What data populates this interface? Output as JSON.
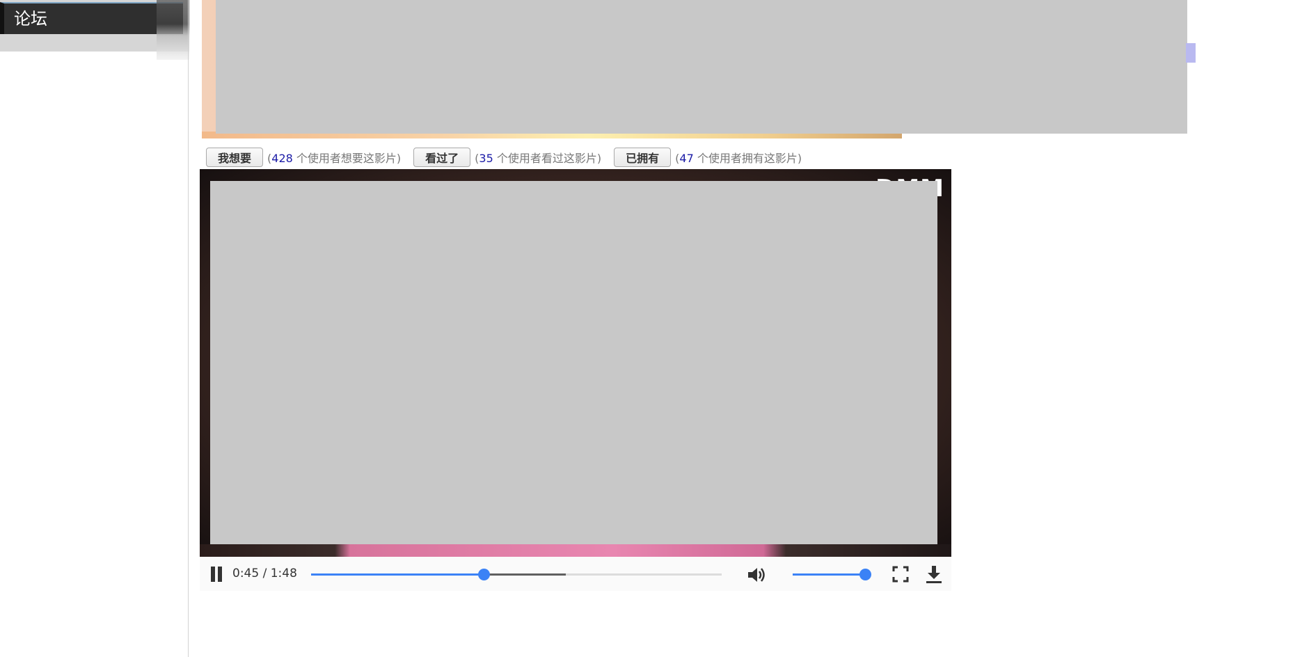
{
  "sidebar": {
    "nav_label": "论坛"
  },
  "actions": [
    {
      "button": "我想要",
      "count": "428",
      "suffix": " 个使用者想要这影片)"
    },
    {
      "button": "看过了",
      "count": "35",
      "suffix": " 个使用者看过这影片)"
    },
    {
      "button": "已拥有",
      "count": "47",
      "suffix": " 个使用者拥有这影片)"
    }
  ],
  "player": {
    "watermark": "DMM",
    "time": "0:45 / 1:48",
    "progress_fraction": 0.42,
    "buffered_fraction": 0.62,
    "volume_fraction": 1.0,
    "icons": [
      "pause-icon",
      "volume-icon",
      "fullscreen-icon",
      "download-icon"
    ]
  },
  "colors": {
    "accent": "#3b82f6",
    "count_text": "#1a1aa6",
    "nav_bg": "#2f2f2f",
    "redaction": "#c8c8c8"
  }
}
